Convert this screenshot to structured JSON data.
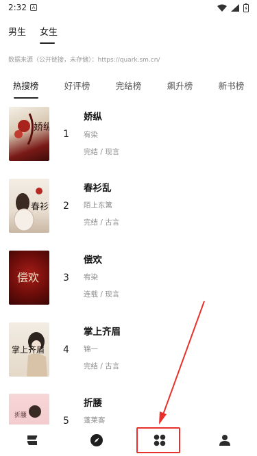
{
  "status_bar": {
    "time": "2:32",
    "a_badge": "A"
  },
  "gender_tabs": [
    {
      "label": "男生",
      "active": false
    },
    {
      "label": "女生",
      "active": true
    }
  ],
  "source_note": "数据来源（公开链接，未存储）：https://quark.sm.cn/",
  "rank_tabs": [
    {
      "label": "热搜榜",
      "active": true
    },
    {
      "label": "好评榜",
      "active": false
    },
    {
      "label": "完结榜",
      "active": false
    },
    {
      "label": "飙升榜",
      "active": false
    },
    {
      "label": "新书榜",
      "active": false
    }
  ],
  "books": [
    {
      "rank": "1",
      "title": "娇纵",
      "author": "宥染",
      "status": "完结 / 现言",
      "cover_text": "娇纵"
    },
    {
      "rank": "2",
      "title": "春衫乱",
      "author": "陌上东篱",
      "status": "完结 / 古言",
      "cover_text": "春衫乱"
    },
    {
      "rank": "3",
      "title": "偿欢",
      "author": "宥染",
      "status": "连载 / 现言",
      "cover_text": "偿欢"
    },
    {
      "rank": "4",
      "title": "掌上齐眉",
      "author": "锦一",
      "status": "完结 / 古言",
      "cover_text": "掌上齐眉"
    },
    {
      "rank": "5",
      "title": "折腰",
      "author": "蓬莱客",
      "status": "",
      "cover_text": "折腰"
    }
  ],
  "bottom_nav": [
    {
      "icon": "bookshelf-icon"
    },
    {
      "icon": "compass-icon"
    },
    {
      "icon": "category-grid-icon"
    },
    {
      "icon": "user-icon"
    }
  ],
  "colors": {
    "annotation_red": "#e8302a",
    "text_primary": "#111111",
    "text_secondary": "#8e8e8e"
  }
}
